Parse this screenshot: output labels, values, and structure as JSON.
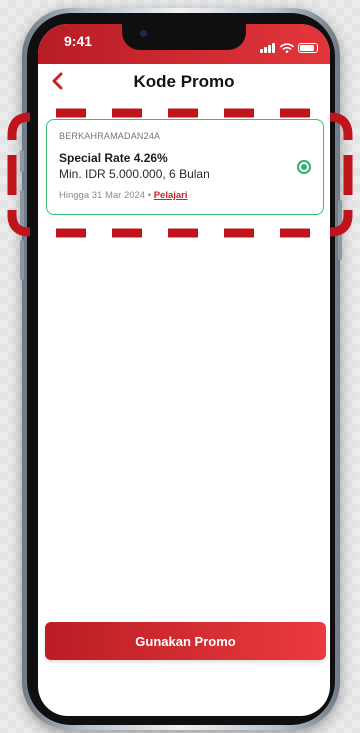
{
  "status_bar": {
    "time": "9:41"
  },
  "header": {
    "title": "Kode Promo"
  },
  "promo": {
    "code": "BERKAHRAMADAN24A",
    "title": "Special Rate 4.26%",
    "subtitle": "Min. IDR 5.000.000, 6 Bulan",
    "valid_until": "Hingga 31 Mar 2024",
    "separator": " • ",
    "learn_more": "Pelajari",
    "selected": true
  },
  "footer": {
    "cta_label": "Gunakan Promo"
  },
  "colors": {
    "brand_red": "#c8232b",
    "selected_green": "#2fb26a",
    "highlight_dash": "#c0141c"
  },
  "icons": {
    "back": "chevron-left-icon",
    "radio": "radio-selected-icon",
    "signal": "signal-icon",
    "wifi": "wifi-icon",
    "battery": "battery-icon"
  }
}
